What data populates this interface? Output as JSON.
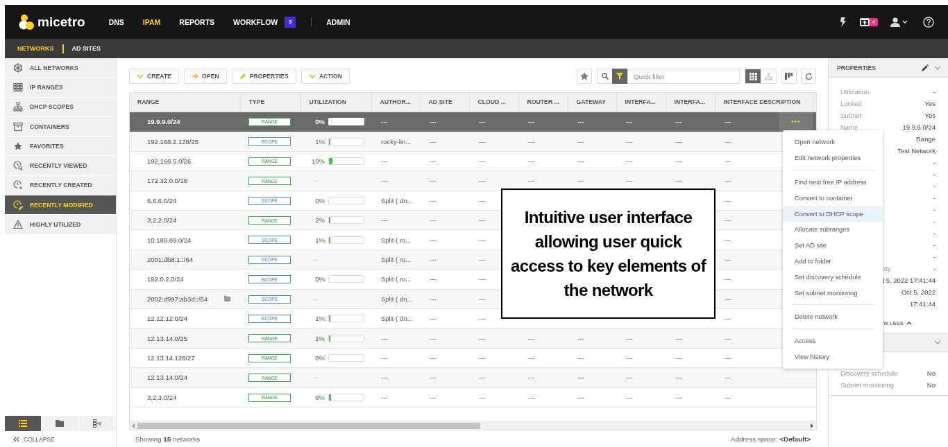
{
  "logo": {
    "text": "micetro"
  },
  "nav": [
    {
      "label": "DNS",
      "selected": false,
      "divider": false
    },
    {
      "label": "IPAM",
      "selected": true,
      "divider": false
    },
    {
      "label": "REPORTS",
      "selected": false,
      "divider": false
    },
    {
      "label": "WORKFLOW",
      "selected": false,
      "divider": false,
      "badge": "3"
    },
    {
      "label": "ADMIN",
      "selected": false,
      "divider": true
    }
  ],
  "notifications": {
    "badge": "4"
  },
  "subnav": [
    {
      "label": "NETWORKS",
      "selected": true
    },
    {
      "label": "AD SITES",
      "selected": false
    }
  ],
  "sidebar": {
    "items": [
      {
        "label": "ALL NETWORKS",
        "selected": false
      },
      {
        "label": "IP RANGES",
        "selected": false
      },
      {
        "label": "DHCP SCOPES",
        "selected": false
      },
      {
        "label": "CONTAINERS",
        "selected": false
      },
      {
        "label": "FAVORITES",
        "selected": false
      },
      {
        "label": "RECENTLY VIEWED",
        "selected": false
      },
      {
        "label": "RECENTLY CREATED",
        "selected": false
      },
      {
        "label": "RECENTLY MODIFIED",
        "selected": true
      },
      {
        "label": "HIGHLY UTILIZED",
        "selected": false
      }
    ],
    "views": [
      {
        "selected": true
      },
      {
        "selected": false
      },
      {
        "selected": false
      }
    ],
    "collapse": "COLLAPSE"
  },
  "toolbar": {
    "buttons": [
      {
        "label": "CREATE"
      },
      {
        "label": "OPEN"
      },
      {
        "label": "PROPERTIES"
      },
      {
        "label": "ACTION"
      }
    ],
    "filter": {
      "placeholder": "Quick filter"
    },
    "view_toggle": [
      {
        "selected": true
      },
      {
        "selected": false
      }
    ]
  },
  "table": {
    "columns": [
      "RANGE",
      "TYPE",
      "UTILIZATION",
      "AUTHOR...",
      "AD SITE",
      "CLOUD ...",
      "ROUTER ...",
      "GATEWAY",
      "INTERFA...",
      "INTERFA...",
      "INTERFACE DESCRIPTION"
    ],
    "rows": [
      {
        "cells": [
          "19.9.9.0/24",
          "RANGE",
          "0%",
          "---",
          "---",
          "---",
          "---",
          "---",
          "---",
          "---",
          "---"
        ],
        "folder": false,
        "kind": "range",
        "meter": true,
        "selected": true,
        "actions": "•••"
      },
      {
        "cells": [
          "192.168.2.128/25",
          "SCOPE",
          "1%",
          "rocky-lin...",
          "---",
          "---",
          "---",
          "---",
          "---",
          "---",
          "---"
        ],
        "folder": false,
        "kind": "scope",
        "meter": true,
        "level": 0.01,
        "selected": false
      },
      {
        "cells": [
          "192.168.5.0/26",
          "RANGE",
          "10%",
          "---",
          "---",
          "---",
          "---",
          "---",
          "---",
          "---",
          "---"
        ],
        "folder": false,
        "kind": "range",
        "meter": true,
        "level": 0.1,
        "selected": false
      },
      {
        "cells": [
          "172.32.0.0/16",
          "RANGE",
          "---",
          "---",
          "---",
          "---",
          "---",
          "---",
          "---",
          "---",
          "---"
        ],
        "folder": false,
        "kind": "range",
        "meter": false,
        "selected": false
      },
      {
        "cells": [
          "6.6.6.0/24",
          "SCOPE",
          "0%",
          "Split ( dn...",
          "---",
          "---",
          null,
          null,
          null,
          null,
          "---"
        ],
        "folder": false,
        "kind": "scope",
        "meter": true,
        "selected": false
      },
      {
        "cells": [
          "3.2.2.0/24",
          "RANGE",
          "2%",
          "---",
          "---",
          "---",
          null,
          null,
          null,
          null,
          "---"
        ],
        "folder": false,
        "kind": "range",
        "meter": true,
        "level": 0.02,
        "selected": false
      },
      {
        "cells": [
          "10.180.89.0/24",
          "SCOPE",
          "1%",
          "Split ( ro...",
          "---",
          "---",
          null,
          null,
          null,
          null,
          "---"
        ],
        "folder": false,
        "kind": "scope",
        "meter": true,
        "level": 0.01,
        "selected": false
      },
      {
        "cells": [
          "2001:db8:1::/64",
          "SCOPE",
          "---",
          "Split ( ro...",
          "---",
          "---",
          null,
          null,
          null,
          null,
          "---"
        ],
        "folder": false,
        "kind": "scope",
        "meter": false,
        "selected": false
      },
      {
        "cells": [
          "192.0.2.0/24",
          "SCOPE",
          "0%",
          "Split ( ro...",
          "---",
          "---",
          null,
          null,
          null,
          null,
          "---"
        ],
        "folder": false,
        "kind": "scope",
        "meter": true,
        "selected": false
      },
      {
        "cells": [
          "2002:d997:ab3d::/64",
          "SCOPE",
          "---",
          "Split ( dn...",
          "---",
          "---",
          null,
          null,
          null,
          null,
          "---"
        ],
        "folder": true,
        "kind": "scope",
        "meter": false,
        "selected": false
      },
      {
        "cells": [
          "12.12.12.0/24",
          "SCOPE",
          "1%",
          "Split ( dn...",
          "---",
          "---",
          null,
          null,
          null,
          null,
          "---"
        ],
        "folder": false,
        "kind": "scope",
        "meter": true,
        "level": 0.01,
        "selected": false
      },
      {
        "cells": [
          "12.13.14.0/25",
          "RANGE",
          "1%",
          "---",
          "---",
          "---",
          "---",
          "---",
          "---",
          "---",
          "---"
        ],
        "folder": false,
        "kind": "range",
        "meter": true,
        "level": 0.01,
        "selected": false
      },
      {
        "cells": [
          "12.13.14.128/27",
          "RANGE",
          "0%",
          "---",
          "---",
          "---",
          "---",
          "---",
          "---",
          "---",
          "---"
        ],
        "folder": false,
        "kind": "range",
        "meter": true,
        "selected": false
      },
      {
        "cells": [
          "12.13.14.0/24",
          "RANGE",
          "---",
          "---",
          "---",
          "---",
          "---",
          "---",
          "---",
          "---",
          "---"
        ],
        "folder": false,
        "kind": "range",
        "meter": false,
        "selected": false
      },
      {
        "cells": [
          "3.2.3.0/24",
          "RANGE",
          "6%",
          "---",
          "---",
          "---",
          "---",
          "---",
          "---",
          "---",
          "---"
        ],
        "folder": false,
        "kind": "range",
        "meter": true,
        "level": 0.06,
        "selected": false
      }
    ]
  },
  "footer": {
    "count": "Showing **15** networks",
    "address_space": "Address space: **<Default>**"
  },
  "properties": {
    "title": "PROPERTIES",
    "rows": [
      {
        "kind": "full",
        "label": "Utilization",
        "value": "-"
      },
      {
        "kind": "full",
        "label": "Locked",
        "value": "Yes"
      },
      {
        "kind": "full",
        "label": "Subnet",
        "value": "Yes"
      },
      {
        "kind": "full",
        "label": "Name",
        "value": "19.9.9.0/24"
      },
      {
        "kind": "value",
        "value": "Range"
      },
      {
        "kind": "value",
        "value": "Test Network"
      },
      {
        "kind": "value",
        "value": "-"
      },
      {
        "kind": "value",
        "value": "-"
      },
      {
        "kind": "value",
        "value": "-"
      },
      {
        "kind": "value",
        "value": "-"
      },
      {
        "kind": "value",
        "value": "-"
      },
      {
        "kind": "value",
        "value": "-"
      },
      {
        "kind": "value",
        "value": "-"
      },
      {
        "kind": "value",
        "value": "-"
      },
      {
        "kind": "value",
        "value": "-"
      },
      {
        "kind": "cut",
        "label": "rty",
        "value": "-"
      },
      {
        "kind": "value",
        "value": "t 5, 2022 17:41:44"
      },
      {
        "kind": "value",
        "value": "Oct 5, 2022"
      },
      {
        "kind": "value",
        "value": "17:41:44"
      }
    ],
    "toggle": "W LESS",
    "section2": {
      "rows": [
        {
          "kind": "full",
          "label": "Discovery schedule",
          "value": "No"
        },
        {
          "kind": "full",
          "label": "Subnet monitoring",
          "value": "No"
        }
      ]
    }
  },
  "context_menu": {
    "groups": [
      [
        {
          "label": "Open network",
          "selected": false
        },
        {
          "label": "Edit network properties",
          "selected": false
        }
      ],
      [
        {
          "label": "Find next free IP address",
          "selected": false
        },
        {
          "label": "Convert to container",
          "selected": false
        },
        {
          "label": "Convert to DHCP scope",
          "selected": true
        },
        {
          "label": "Allocate subranges",
          "selected": false
        },
        {
          "label": "Set AD site",
          "selected": false
        },
        {
          "label": "Add to folder",
          "selected": false
        },
        {
          "label": "Set discovery schedule",
          "selected": false
        },
        {
          "label": "Set subnet monitoring",
          "selected": false
        }
      ],
      [
        {
          "label": "Delete network",
          "selected": false
        }
      ],
      [
        {
          "label": "Access",
          "selected": false
        },
        {
          "label": "View history",
          "selected": false
        }
      ]
    ]
  },
  "callout": {
    "text": "Intuitive user interface allowing user quick access to key elements of the network"
  }
}
